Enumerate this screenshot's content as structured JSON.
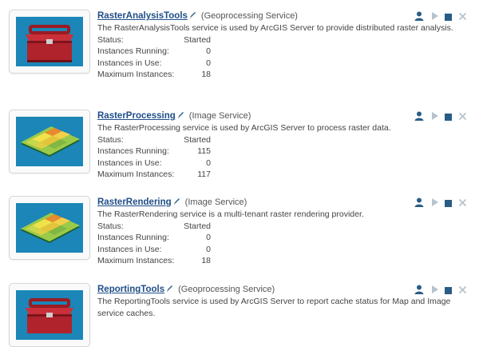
{
  "labels": {
    "status": "Status:",
    "running": "Instances Running:",
    "in_use": "Instances in Use:",
    "max": "Maximum Instances:"
  },
  "services": [
    {
      "name": "RasterAnalysisTools",
      "type": "(Geoprocessing Service)",
      "description": "The RasterAnalysisTools service is used by ArcGIS Server to provide distributed raster analysis.",
      "status": "Started",
      "running": "0",
      "in_use": "0",
      "max": "18",
      "icon": "toolbox-icon"
    },
    {
      "name": "RasterProcessing",
      "type": "(Image Service)",
      "description": "The RasterProcessing service is used by ArcGIS Server to process raster data.",
      "status": "Started",
      "running": "115",
      "in_use": "0",
      "max": "117",
      "icon": "raster-map-icon"
    },
    {
      "name": "RasterRendering",
      "type": "(Image Service)",
      "description": "The RasterRendering service is a multi-tenant raster rendering provider.",
      "status": "Started",
      "running": "0",
      "in_use": "0",
      "max": "18",
      "icon": "raster-map-icon"
    },
    {
      "name": "ReportingTools",
      "type": "(Geoprocessing Service)",
      "description": "The ReportingTools service is used by ArcGIS Server to report cache status for Map and Image service caches.",
      "icon": "toolbox-icon"
    }
  ],
  "colors": {
    "link": "#1f4e88",
    "icon_blue": "#2a5d86",
    "icon_gray": "#b7c3cc",
    "thumb_bg": "#1b86b7"
  }
}
